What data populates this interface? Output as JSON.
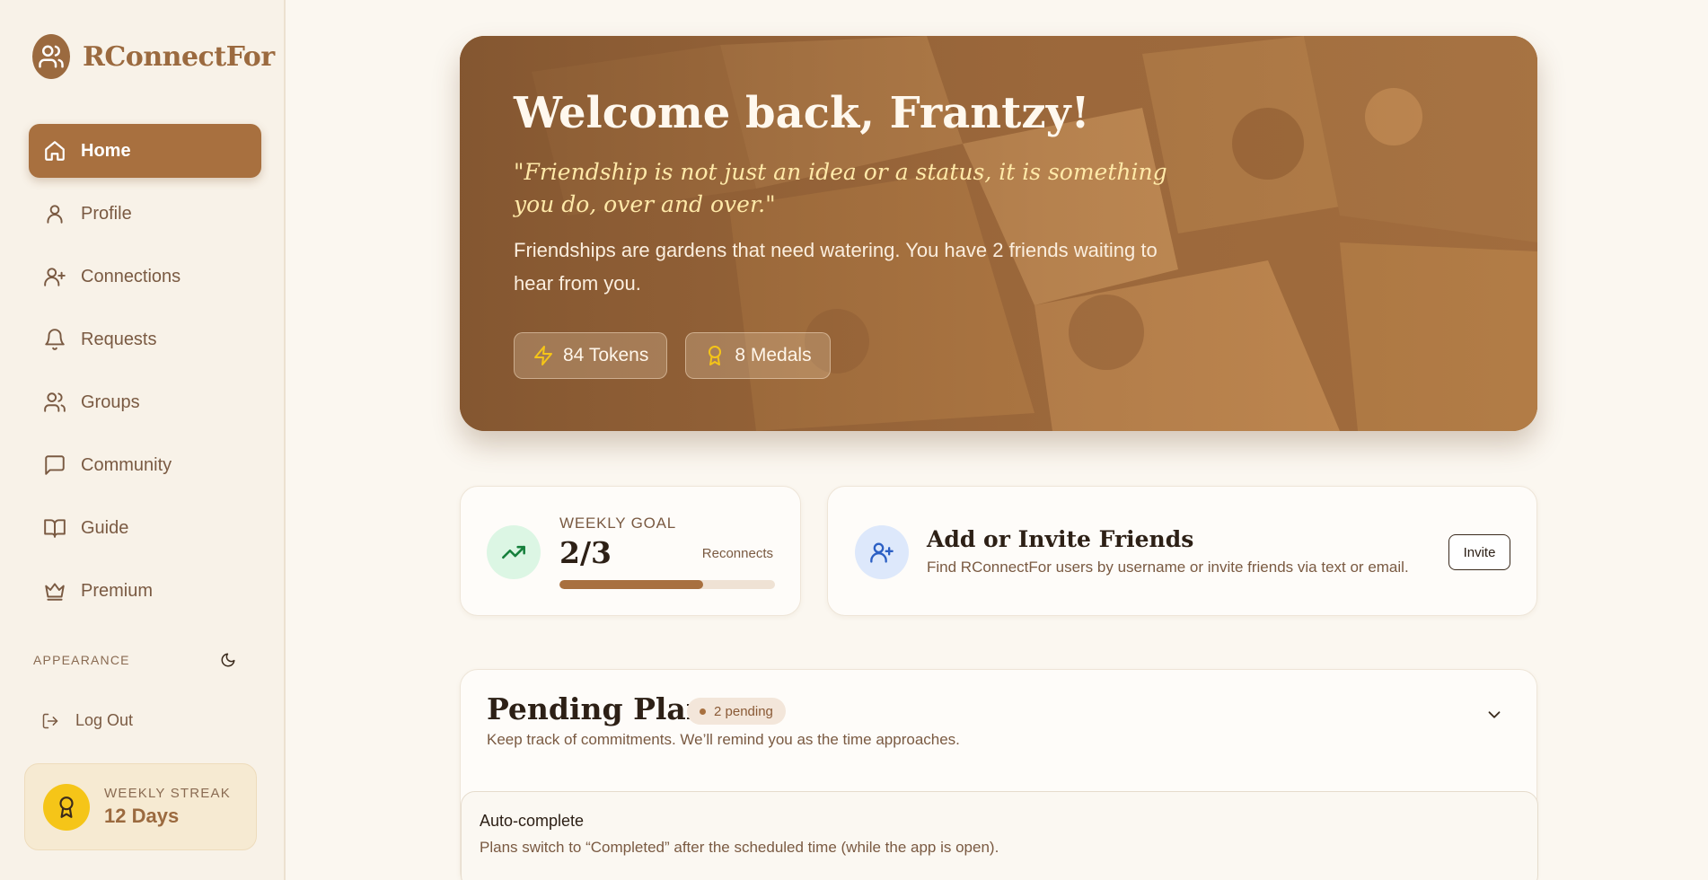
{
  "brand": {
    "name": "RConnectFor"
  },
  "sidebar": {
    "items": [
      {
        "label": "Home",
        "icon": "home-icon",
        "active": true
      },
      {
        "label": "Profile",
        "icon": "user-icon"
      },
      {
        "label": "Connections",
        "icon": "user-plus-icon"
      },
      {
        "label": "Requests",
        "icon": "bell-icon"
      },
      {
        "label": "Groups",
        "icon": "users-icon"
      },
      {
        "label": "Community",
        "icon": "message-square-icon"
      },
      {
        "label": "Guide",
        "icon": "book-icon"
      },
      {
        "label": "Premium",
        "icon": "crown-icon"
      }
    ],
    "appearance_label": "APPEARANCE",
    "logout_label": "Log Out",
    "streak": {
      "label": "WEEKLY STREAK",
      "value": "12 Days"
    }
  },
  "hero": {
    "title": "Welcome back, Frantzy!",
    "quote": "\"Friendship is not just an idea or a status, it is something you do, over and over.\"",
    "text": "Friendships are gardens that need watering. You have 2 friends waiting to hear from you.",
    "tokens": "84 Tokens",
    "medals": "8 Medals"
  },
  "weekly_goal": {
    "label": "WEEKLY GOAL",
    "value": "2/3",
    "unit": "Reconnects",
    "progress": 0.667
  },
  "invite": {
    "title": "Add or Invite Friends",
    "subtitle": "Find RConnectFor users by username or invite friends via text or email.",
    "button": "Invite"
  },
  "plans": {
    "title": "Pending Plans",
    "pill": "2 pending",
    "subtitle": "Keep track of commitments. We’ll remind you as the time approaches.",
    "auto_title": "Auto-complete",
    "auto_sub": "Plans switch to “Completed” after the scheduled time (while the app is open)."
  },
  "colors": {
    "accent": "#a8703f",
    "background": "#fbf7f0",
    "streak_badge": "#f5c518"
  }
}
